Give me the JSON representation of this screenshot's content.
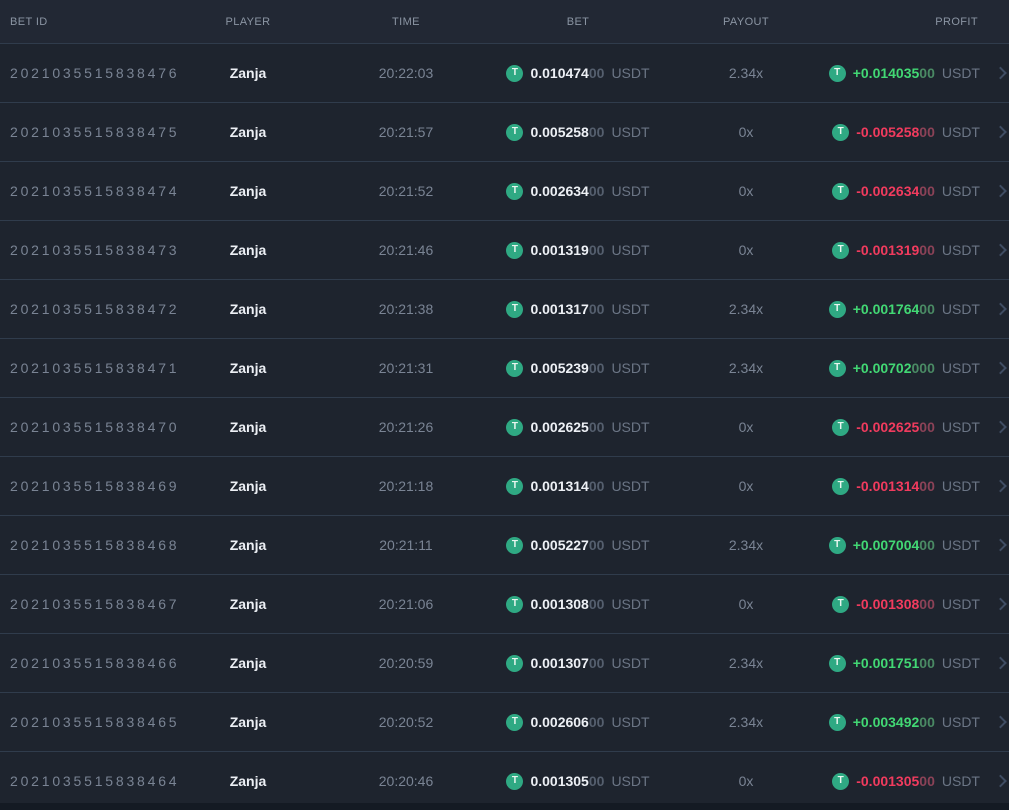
{
  "colors": {
    "positive": "#42d874",
    "negative": "#f13b5e",
    "tether": "#2fa983"
  },
  "header": {
    "bet_id": "BET ID",
    "player": "PLAYER",
    "time": "TIME",
    "bet": "BET",
    "payout": "PAYOUT",
    "profit": "PROFIT"
  },
  "currency": "USDT",
  "coin_symbol": "T",
  "rows": [
    {
      "bet_id": "2021035515838476",
      "player": "Zanja",
      "time": "20:22:03",
      "bet_main": "0.010474",
      "bet_dim": "00",
      "payout": "2.34x",
      "profit_main": "+0.014035",
      "profit_dim": "00",
      "positive": true
    },
    {
      "bet_id": "2021035515838475",
      "player": "Zanja",
      "time": "20:21:57",
      "bet_main": "0.005258",
      "bet_dim": "00",
      "payout": "0x",
      "profit_main": "-0.005258",
      "profit_dim": "00",
      "positive": false
    },
    {
      "bet_id": "2021035515838474",
      "player": "Zanja",
      "time": "20:21:52",
      "bet_main": "0.002634",
      "bet_dim": "00",
      "payout": "0x",
      "profit_main": "-0.002634",
      "profit_dim": "00",
      "positive": false
    },
    {
      "bet_id": "2021035515838473",
      "player": "Zanja",
      "time": "20:21:46",
      "bet_main": "0.001319",
      "bet_dim": "00",
      "payout": "0x",
      "profit_main": "-0.001319",
      "profit_dim": "00",
      "positive": false
    },
    {
      "bet_id": "2021035515838472",
      "player": "Zanja",
      "time": "20:21:38",
      "bet_main": "0.001317",
      "bet_dim": "00",
      "payout": "2.34x",
      "profit_main": "+0.001764",
      "profit_dim": "00",
      "positive": true
    },
    {
      "bet_id": "2021035515838471",
      "player": "Zanja",
      "time": "20:21:31",
      "bet_main": "0.005239",
      "bet_dim": "00",
      "payout": "2.34x",
      "profit_main": "+0.00702",
      "profit_dim": "000",
      "positive": true
    },
    {
      "bet_id": "2021035515838470",
      "player": "Zanja",
      "time": "20:21:26",
      "bet_main": "0.002625",
      "bet_dim": "00",
      "payout": "0x",
      "profit_main": "-0.002625",
      "profit_dim": "00",
      "positive": false
    },
    {
      "bet_id": "2021035515838469",
      "player": "Zanja",
      "time": "20:21:18",
      "bet_main": "0.001314",
      "bet_dim": "00",
      "payout": "0x",
      "profit_main": "-0.001314",
      "profit_dim": "00",
      "positive": false
    },
    {
      "bet_id": "2021035515838468",
      "player": "Zanja",
      "time": "20:21:11",
      "bet_main": "0.005227",
      "bet_dim": "00",
      "payout": "2.34x",
      "profit_main": "+0.007004",
      "profit_dim": "00",
      "positive": true
    },
    {
      "bet_id": "2021035515838467",
      "player": "Zanja",
      "time": "20:21:06",
      "bet_main": "0.001308",
      "bet_dim": "00",
      "payout": "0x",
      "profit_main": "-0.001308",
      "profit_dim": "00",
      "positive": false
    },
    {
      "bet_id": "2021035515838466",
      "player": "Zanja",
      "time": "20:20:59",
      "bet_main": "0.001307",
      "bet_dim": "00",
      "payout": "2.34x",
      "profit_main": "+0.001751",
      "profit_dim": "00",
      "positive": true
    },
    {
      "bet_id": "2021035515838465",
      "player": "Zanja",
      "time": "20:20:52",
      "bet_main": "0.002606",
      "bet_dim": "00",
      "payout": "2.34x",
      "profit_main": "+0.003492",
      "profit_dim": "00",
      "positive": true
    },
    {
      "bet_id": "2021035515838464",
      "player": "Zanja",
      "time": "20:20:46",
      "bet_main": "0.001305",
      "bet_dim": "00",
      "payout": "0x",
      "profit_main": "-0.001305",
      "profit_dim": "00",
      "positive": false
    }
  ]
}
